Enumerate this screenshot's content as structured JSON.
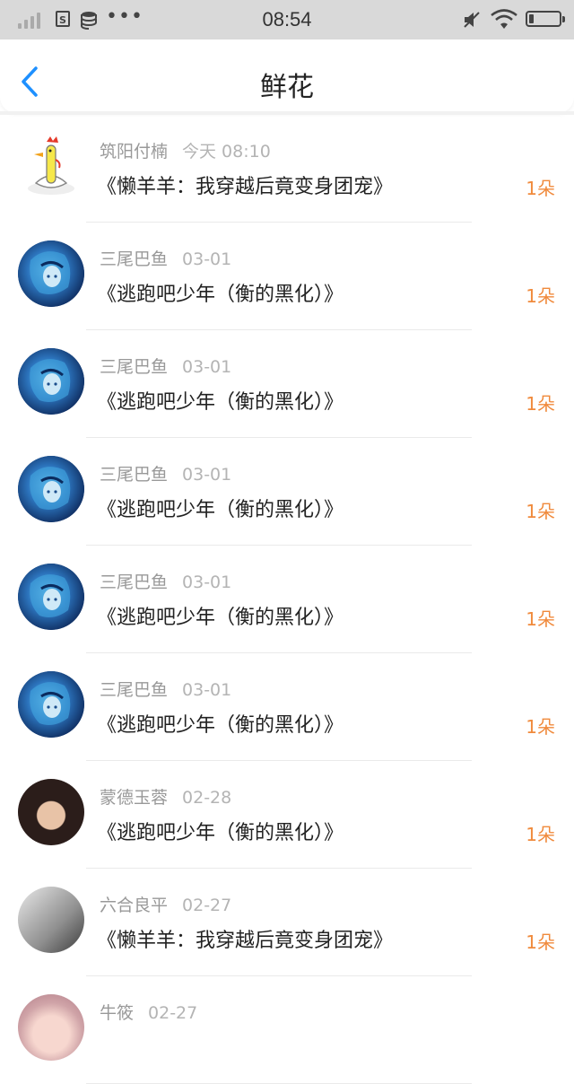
{
  "status_bar": {
    "time": "08:54",
    "sim_label": "S",
    "battery_level": 0.15,
    "icons": [
      "signal-icon",
      "sim-icon",
      "database-icon",
      "more-dots-icon",
      "mute-icon",
      "wifi-icon",
      "battery-icon"
    ]
  },
  "header": {
    "title": "鲜花",
    "back_icon": "chevron-left-icon",
    "accent_color": "#1e90ff"
  },
  "list": [
    {
      "name": "筑阳付楠",
      "date": "今天 08:10",
      "book": "《懒羊羊：我穿越后竟变身团宠》",
      "count": "1朵",
      "avatar": "chicken"
    },
    {
      "name": "三尾巴鱼",
      "date": "03-01",
      "book": "《逃跑吧少年（衡的黑化）》",
      "count": "1朵",
      "avatar": "anime"
    },
    {
      "name": "三尾巴鱼",
      "date": "03-01",
      "book": "《逃跑吧少年（衡的黑化）》",
      "count": "1朵",
      "avatar": "anime"
    },
    {
      "name": "三尾巴鱼",
      "date": "03-01",
      "book": "《逃跑吧少年（衡的黑化）》",
      "count": "1朵",
      "avatar": "anime"
    },
    {
      "name": "三尾巴鱼",
      "date": "03-01",
      "book": "《逃跑吧少年（衡的黑化）》",
      "count": "1朵",
      "avatar": "anime"
    },
    {
      "name": "三尾巴鱼",
      "date": "03-01",
      "book": "《逃跑吧少年（衡的黑化）》",
      "count": "1朵",
      "avatar": "anime"
    },
    {
      "name": "蒙德玉蓉",
      "date": "02-28",
      "book": "《逃跑吧少年（衡的黑化）》",
      "count": "1朵",
      "avatar": "girl"
    },
    {
      "name": "六合良平",
      "date": "02-27",
      "book": "《懒羊羊：我穿越后竟变身团宠》",
      "count": "1朵",
      "avatar": "gray"
    },
    {
      "name": "牛筱",
      "date": "02-27",
      "book": "",
      "count": "",
      "avatar": "pink"
    }
  ],
  "colors": {
    "count": "#f08a3c",
    "meta": "#999999",
    "title": "#222222"
  }
}
